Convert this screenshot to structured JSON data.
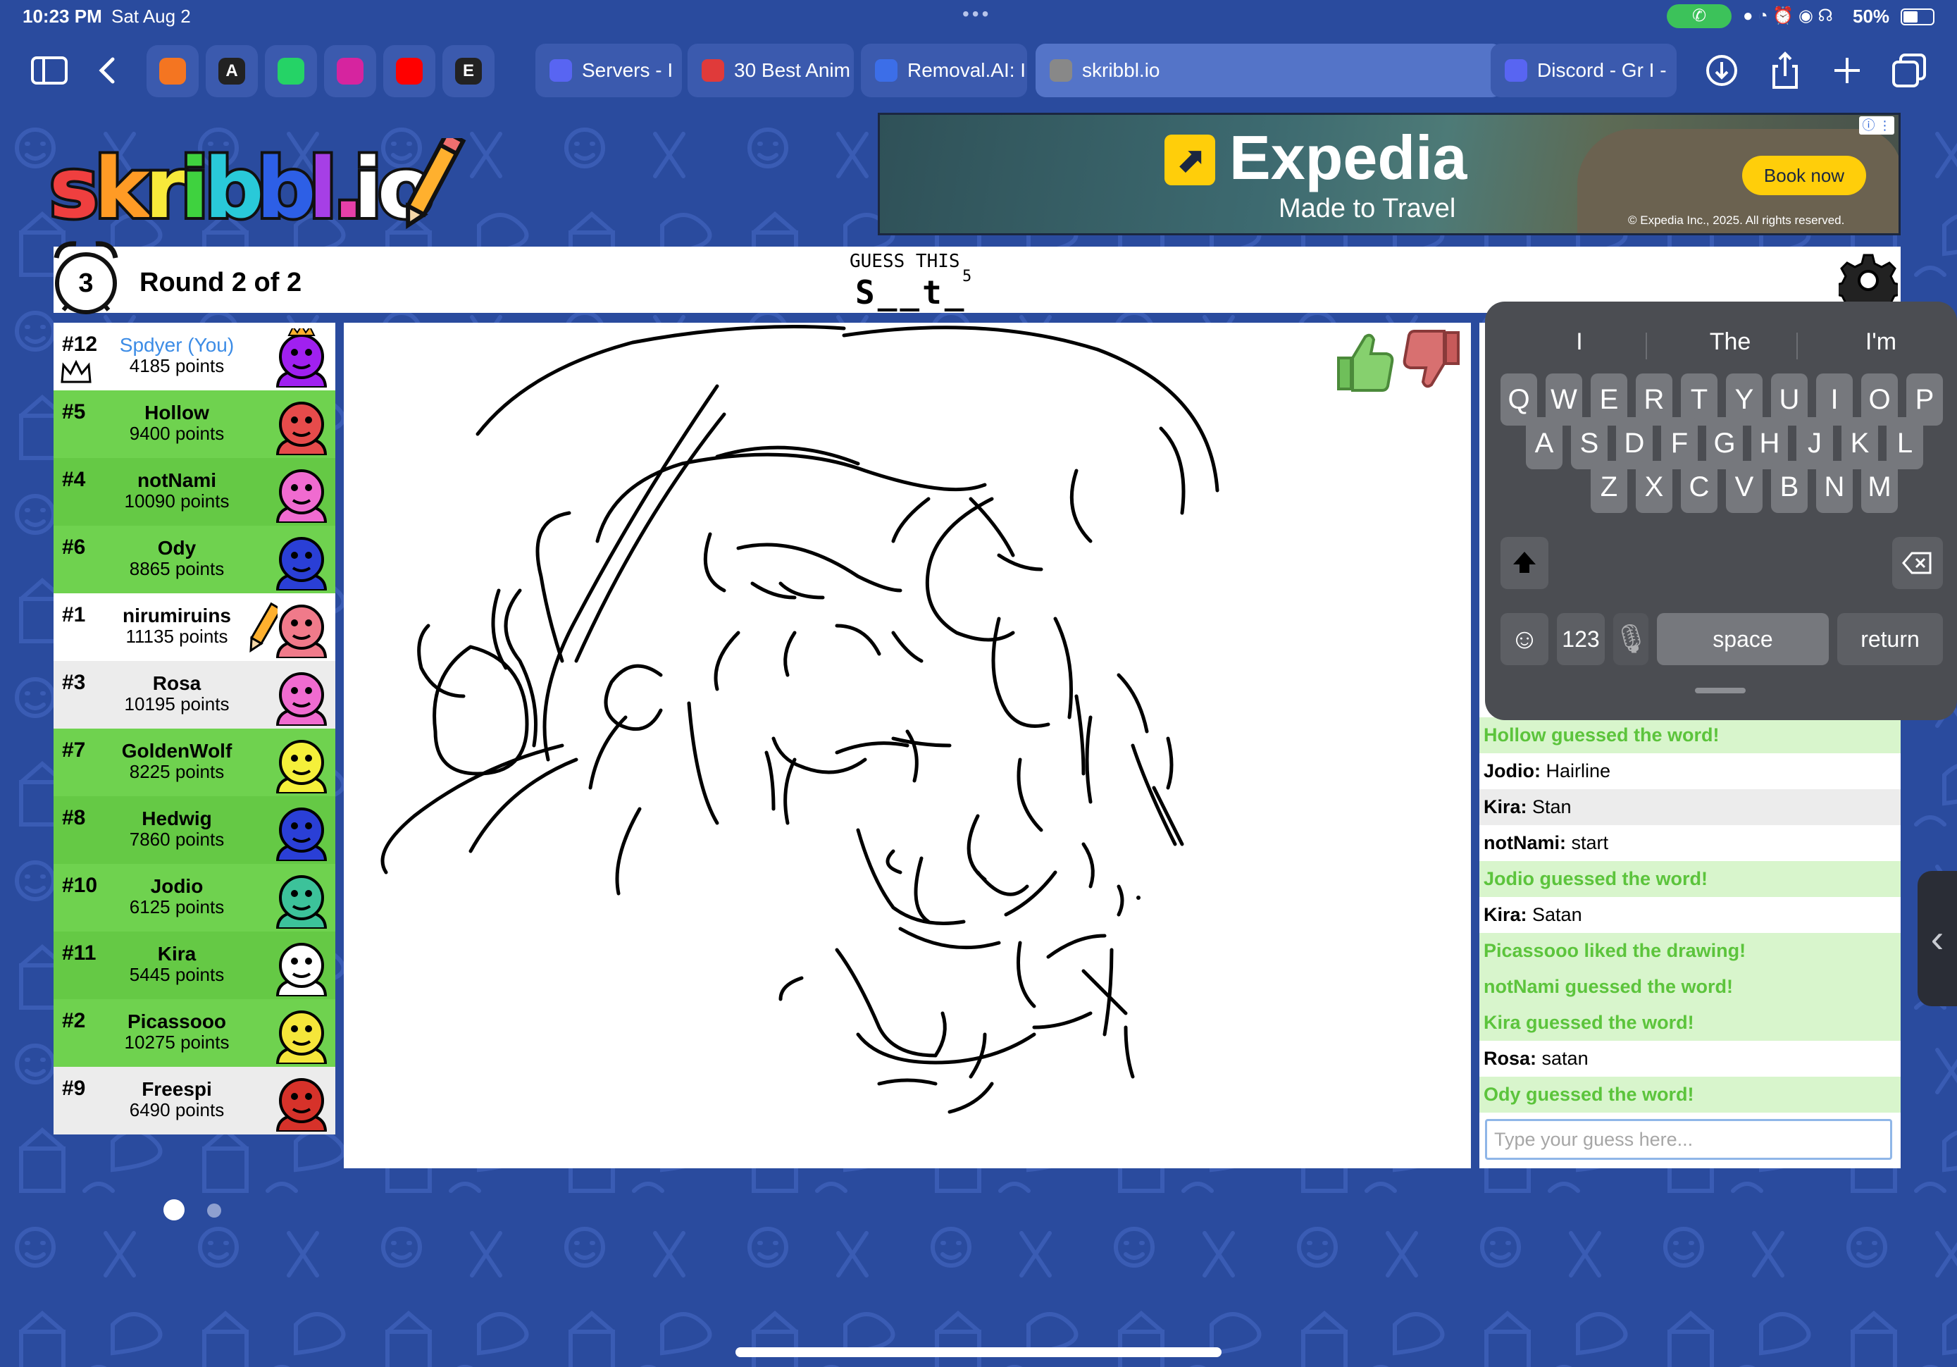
{
  "status_bar": {
    "time": "10:23 PM",
    "date": "Sat Aug 2",
    "battery": "50%",
    "call_icon": "phone-icon"
  },
  "browser": {
    "favorites": [
      {
        "icon": "crunchyroll-icon",
        "glyph": "",
        "color": "#f47521"
      },
      {
        "icon": "app-a-icon",
        "glyph": "A",
        "color": "#222222"
      },
      {
        "icon": "whatsapp-icon",
        "glyph": "",
        "color": "#25d366"
      },
      {
        "icon": "instagram-icon",
        "glyph": "",
        "color": "#d6249f"
      },
      {
        "icon": "youtube-icon",
        "glyph": "",
        "color": "#ff0000"
      },
      {
        "icon": "app-e-icon",
        "glyph": "E",
        "color": "#222222"
      }
    ],
    "tabs": [
      {
        "label": "Servers - I",
        "color": "#5865f2"
      },
      {
        "label": "30 Best Anim",
        "color": "#e03a3a"
      },
      {
        "label": "Removal.AI: I",
        "color": "#3c6ee8"
      },
      {
        "label": "skribbl.io",
        "color": "#888888"
      },
      {
        "label": "Discord - Gr I -",
        "color": "#5865f2"
      }
    ]
  },
  "game": {
    "logo_text": "skribbl.io",
    "timer": "3",
    "round_label": "Round 2 of 2",
    "guess_label": "GUESS THIS",
    "hint": "S__t_",
    "hint_count": "5",
    "players": [
      {
        "rank": "#12",
        "name": "Spdyer (You)",
        "points": "4185 points",
        "bg": "#ffffff",
        "you": true,
        "crown": true,
        "avatar_color": "#a020f0"
      },
      {
        "rank": "#5",
        "name": "Hollow",
        "points": "9400 points",
        "bg": "#6fd24f",
        "avatar_color": "#e64b4b"
      },
      {
        "rank": "#4",
        "name": "notNami",
        "points": "10090 points",
        "bg": "#65c945",
        "avatar_color": "#f06bd0"
      },
      {
        "rank": "#6",
        "name": "Ody",
        "points": "8865 points",
        "bg": "#6fd24f",
        "avatar_color": "#2a3fd6"
      },
      {
        "rank": "#1",
        "name": "nirumiruins",
        "points": "11135 points",
        "bg": "#ffffff",
        "drawing": true,
        "avatar_color": "#f07a8a"
      },
      {
        "rank": "#3",
        "name": "Rosa",
        "points": "10195 points",
        "bg": "#ececec",
        "avatar_color": "#f06bd0"
      },
      {
        "rank": "#7",
        "name": "GoldenWolf",
        "points": "8225 points",
        "bg": "#6fd24f",
        "avatar_color": "#f5f03a"
      },
      {
        "rank": "#8",
        "name": "Hedwig",
        "points": "7860 points",
        "bg": "#65c945",
        "avatar_color": "#2a3fd6"
      },
      {
        "rank": "#10",
        "name": "Jodio",
        "points": "6125 points",
        "bg": "#6fd24f",
        "avatar_color": "#3cc29a"
      },
      {
        "rank": "#11",
        "name": "Kira",
        "points": "5445 points",
        "bg": "#65c945",
        "avatar_color": "#ffffff"
      },
      {
        "rank": "#2",
        "name": "Picassooo",
        "points": "10275 points",
        "bg": "#6fd24f",
        "avatar_color": "#f5e63a"
      },
      {
        "rank": "#9",
        "name": "Freespi",
        "points": "6490 points",
        "bg": "#ececec",
        "avatar_color": "#d6322a"
      }
    ],
    "chat": [
      {
        "type": "system",
        "text": "Hollow guessed the word!"
      },
      {
        "type": "message",
        "user": "Jodio:",
        "text": "Hairline"
      },
      {
        "type": "message",
        "user": "Kira:",
        "text": "Stan"
      },
      {
        "type": "message",
        "user": "notNami:",
        "text": "start"
      },
      {
        "type": "system",
        "text": "Jodio guessed the word!"
      },
      {
        "type": "message",
        "user": "Kira:",
        "text": "Satan"
      },
      {
        "type": "system",
        "text": "Picassooo liked the drawing!"
      },
      {
        "type": "system",
        "text": "notNami guessed the word!"
      },
      {
        "type": "system",
        "text": "Kira guessed the word!"
      },
      {
        "type": "message",
        "user": "Rosa:",
        "text": "satan"
      },
      {
        "type": "system",
        "text": "Ody guessed the word!"
      }
    ],
    "guess_placeholder": "Type your guess here..."
  },
  "ad": {
    "brand": "Expedia",
    "tagline": "Made to Travel",
    "cta": "Book now",
    "copyright": "© Expedia Inc., 2025. All rights reserved."
  },
  "keyboard": {
    "suggestions": [
      "I",
      "The",
      "I'm"
    ],
    "row1": [
      "Q",
      "W",
      "E",
      "R",
      "T",
      "Y",
      "U",
      "I",
      "O",
      "P"
    ],
    "row2": [
      "A",
      "S",
      "D",
      "F",
      "G",
      "H",
      "J",
      "K",
      "L"
    ],
    "row3": [
      "Z",
      "X",
      "C",
      "V",
      "B",
      "N",
      "M"
    ],
    "numbers_key": "123",
    "space_key": "space",
    "return_key": "return"
  },
  "colors": {
    "background": "#2a4b9e",
    "guessed_green": "#5cc43c",
    "row_green": "#6fd24f",
    "you_blue": "#3c8ce6"
  }
}
